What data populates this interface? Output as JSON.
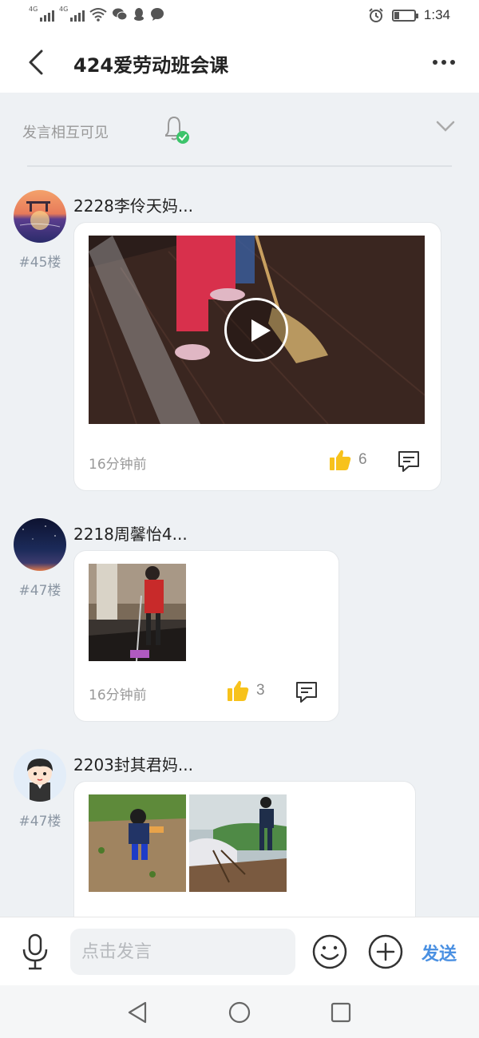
{
  "status_bar": {
    "signal1_label": "4G",
    "signal2_label": "4G",
    "time": "1:34",
    "battery_percent": 25
  },
  "header": {
    "title": "424爱劳动班会课"
  },
  "notice": {
    "text": "发言相互可见"
  },
  "posts": [
    {
      "author": "2228李伶天妈...",
      "floor": "#45楼",
      "media_type": "video",
      "timestamp": "16分钟前",
      "likes": "6"
    },
    {
      "author": "2218周馨怡4...",
      "floor": "#47楼",
      "media_type": "image",
      "timestamp": "16分钟前",
      "likes": "3"
    },
    {
      "author": "2203封其君妈...",
      "floor": "#47楼",
      "media_type": "images",
      "timestamp": "",
      "likes": ""
    }
  ],
  "input_bar": {
    "placeholder": "点击发言",
    "send_label": "发送"
  },
  "colors": {
    "accent": "#4a90e2",
    "like": "#f7c21b",
    "badge_green": "#3cc46b"
  }
}
